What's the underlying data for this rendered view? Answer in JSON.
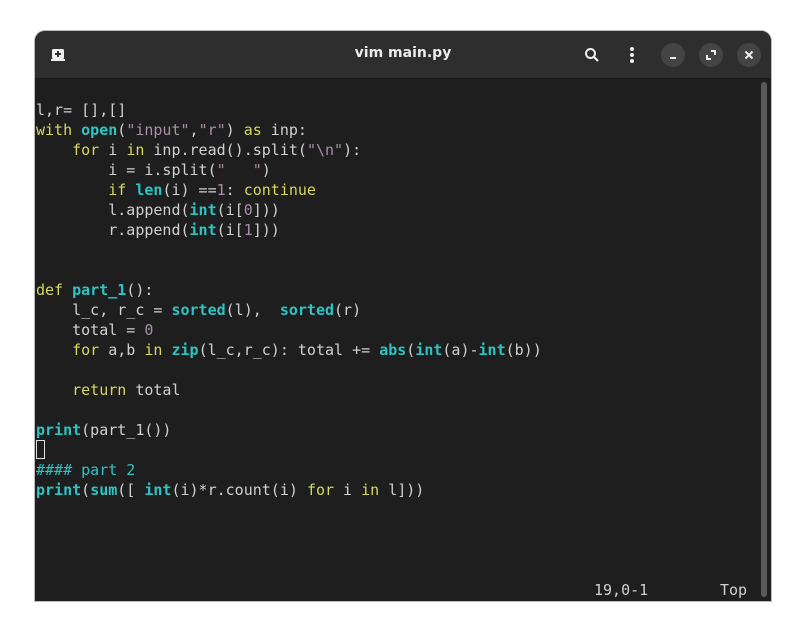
{
  "window": {
    "title": "vim main.py"
  },
  "icons": {
    "new_tab": "new-tab-icon",
    "search": "search-icon",
    "menu": "kebab-menu-icon",
    "minimize": "minimize-icon",
    "maximize": "maximize-icon",
    "close": "close-icon"
  },
  "colors": {
    "keyword": "#d7d75f",
    "builtin": "#2ec4c4",
    "literal": "#a98fa9",
    "text": "#d0d0d0",
    "background": "#1e1e1e"
  },
  "code": [
    [],
    [
      [
        "l,r= [],[]",
        ""
      ]
    ],
    [
      [
        "with",
        "kw"
      ],
      [
        " ",
        ""
      ],
      [
        "open",
        "bi"
      ],
      [
        "(",
        ""
      ],
      [
        "\"input\"",
        "st"
      ],
      [
        ",",
        ""
      ],
      [
        "\"r\"",
        "st"
      ],
      [
        ") ",
        ""
      ],
      [
        "as",
        "kw"
      ],
      [
        " inp:",
        ""
      ]
    ],
    [
      [
        "    ",
        ""
      ],
      [
        "for",
        "kw"
      ],
      [
        " i ",
        ""
      ],
      [
        "in",
        "kw"
      ],
      [
        " inp.read().split(",
        ""
      ],
      [
        "\"\\n\"",
        "st"
      ],
      [
        "):",
        ""
      ]
    ],
    [
      [
        "        i = i.split(",
        ""
      ],
      [
        "\"   \"",
        "st"
      ],
      [
        ")",
        ""
      ]
    ],
    [
      [
        "        ",
        ""
      ],
      [
        "if",
        "kw"
      ],
      [
        " ",
        ""
      ],
      [
        "len",
        "bi"
      ],
      [
        "(i) ==",
        ""
      ],
      [
        "1",
        "st"
      ],
      [
        ": ",
        ""
      ],
      [
        "continue",
        "kw"
      ]
    ],
    [
      [
        "        l.append(",
        ""
      ],
      [
        "int",
        "bi"
      ],
      [
        "(i[",
        ""
      ],
      [
        "0",
        "st"
      ],
      [
        "]))",
        ""
      ]
    ],
    [
      [
        "        r.append(",
        ""
      ],
      [
        "int",
        "bi"
      ],
      [
        "(i[",
        ""
      ],
      [
        "1",
        "st"
      ],
      [
        "]))",
        ""
      ]
    ],
    [],
    [],
    [
      [
        "def",
        "kw"
      ],
      [
        " ",
        ""
      ],
      [
        "part_1",
        "bi"
      ],
      [
        "():",
        ""
      ]
    ],
    [
      [
        "    l_c, r_c = ",
        ""
      ],
      [
        "sorted",
        "bi"
      ],
      [
        "(l),  ",
        ""
      ],
      [
        "sorted",
        "bi"
      ],
      [
        "(r)",
        ""
      ]
    ],
    [
      [
        "    total = ",
        ""
      ],
      [
        "0",
        "st"
      ]
    ],
    [
      [
        "    ",
        ""
      ],
      [
        "for",
        "kw"
      ],
      [
        " a,b ",
        ""
      ],
      [
        "in",
        "kw"
      ],
      [
        " ",
        ""
      ],
      [
        "zip",
        "bi"
      ],
      [
        "(l_c,r_c): total += ",
        ""
      ],
      [
        "abs",
        "bi"
      ],
      [
        "(",
        ""
      ],
      [
        "int",
        "bi"
      ],
      [
        "(a)-",
        ""
      ],
      [
        "int",
        "bi"
      ],
      [
        "(b))",
        ""
      ]
    ],
    [],
    [
      [
        "    ",
        ""
      ],
      [
        "return",
        "kw"
      ],
      [
        " total",
        ""
      ]
    ],
    [],
    [
      [
        "print",
        "bi"
      ],
      [
        "(part_1())",
        ""
      ]
    ],
    [
      [
        "",
        "cursor"
      ]
    ],
    [
      [
        "#### part 2",
        "cm"
      ]
    ],
    [
      [
        "print",
        "bi"
      ],
      [
        "(",
        ""
      ],
      [
        "sum",
        "bi"
      ],
      [
        "([ ",
        ""
      ],
      [
        "int",
        "bi"
      ],
      [
        "(i)*r.count(i) ",
        ""
      ],
      [
        "for",
        "kw"
      ],
      [
        " i ",
        ""
      ],
      [
        "in",
        "kw"
      ],
      [
        " l]))",
        ""
      ]
    ]
  ],
  "status": {
    "position": "19,0-1",
    "scroll": "Top"
  }
}
